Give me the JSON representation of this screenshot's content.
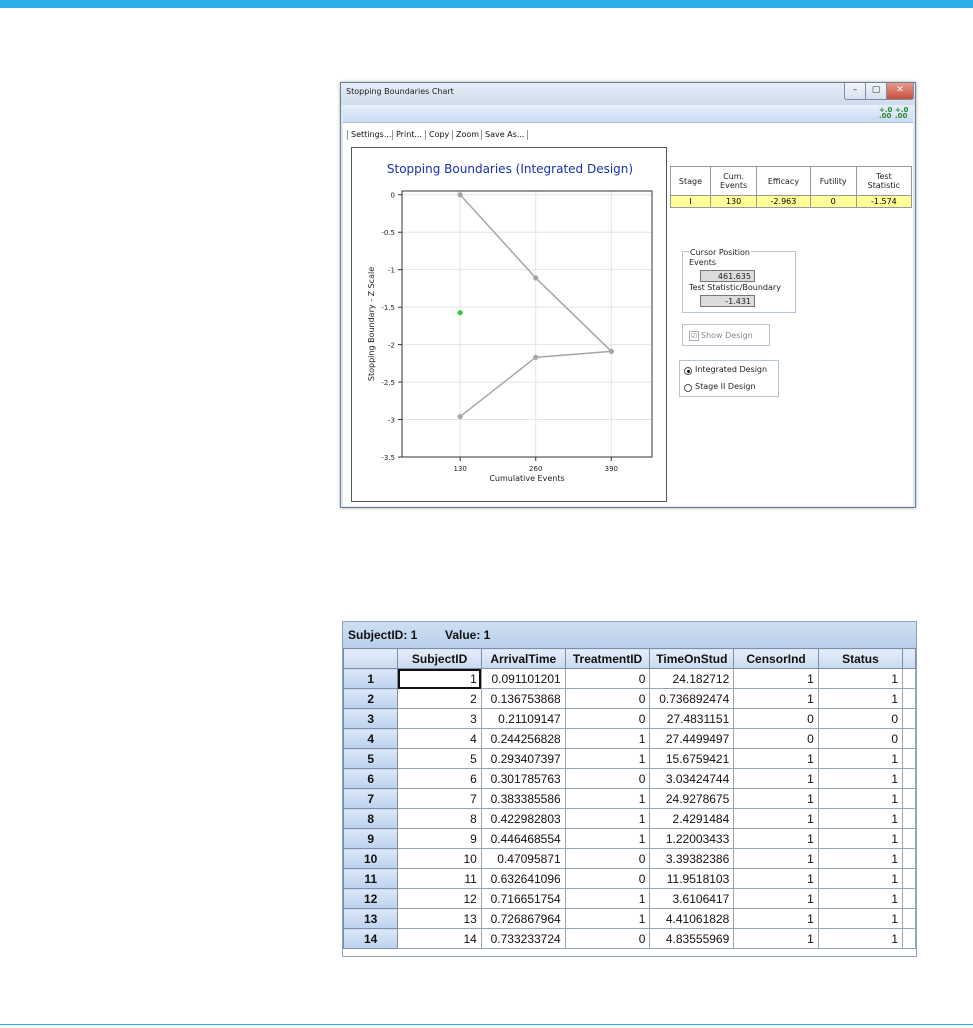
{
  "window": {
    "title": "Stopping Boundaries Chart",
    "min_glyph": "–",
    "max_glyph": "▢",
    "close_glyph": "✕",
    "tool_icon_1": "+.0 .00",
    "tool_icon_2": "+.0 .00"
  },
  "menu": {
    "settings": "Settings...",
    "print": "Print...",
    "copy": "Copy",
    "zoom": "Zoom",
    "save_as": "Save As..."
  },
  "chart_data": {
    "type": "line",
    "title": "Stopping Boundaries (Integrated Design)",
    "xlabel": "Cumulative Events",
    "ylabel": "Stopping Boundary - Z Scale",
    "x_ticks": [
      130,
      260,
      390
    ],
    "y_ticks": [
      0,
      -0.5,
      -1,
      -1.5,
      -2,
      -2.5,
      -3,
      -3.5
    ],
    "y_tick_labels": [
      "0",
      "-0.5",
      "-1",
      "-1.5",
      "-2",
      "-2.5",
      "-3",
      "-3.5"
    ],
    "xlim": [
      30,
      460
    ],
    "ylim": [
      -3.5,
      0.05
    ],
    "grid": true,
    "series": [
      {
        "color": "#a6a6a6",
        "points": [
          [
            130,
            0
          ],
          [
            260,
            -1.11
          ],
          [
            390,
            -2.09
          ]
        ]
      },
      {
        "color": "#a6a6a6",
        "points": [
          [
            130,
            -2.96
          ],
          [
            260,
            -2.17
          ],
          [
            390,
            -2.09
          ]
        ]
      }
    ],
    "markers": [
      {
        "color": "#33cc33",
        "points": [
          [
            130,
            -1.574
          ]
        ]
      }
    ]
  },
  "stage_table": {
    "headers": [
      "Stage",
      "Cum.\nEvents",
      "Efficacy",
      "Futility",
      "Test\nStatistic"
    ],
    "rows": [
      [
        "I",
        "130",
        "-2.963",
        "0",
        "-1.574"
      ]
    ]
  },
  "cursor": {
    "legend": "Cursor Position",
    "events_label": "Events",
    "events_value": "461.635",
    "ts_label": "Test Statistic/Boundary",
    "ts_value": "-1.431"
  },
  "show_design": {
    "label": "Show Design",
    "check": "☑"
  },
  "design_options": {
    "integrated": "Integrated Design",
    "stage2": "Stage II Design"
  },
  "datagrid": {
    "subject_label": "SubjectID: 1",
    "value_label": "Value: 1",
    "columns": [
      "SubjectID",
      "ArrivalTime",
      "TreatmentID",
      "TimeOnStud",
      "CensorInd",
      "Status"
    ],
    "rows": [
      [
        "1",
        "1",
        "0.091101201",
        "0",
        "24.182712",
        "1",
        "1"
      ],
      [
        "2",
        "2",
        "0.136753868",
        "0",
        "0.736892474",
        "1",
        "1"
      ],
      [
        "3",
        "3",
        "0.21109147",
        "0",
        "27.4831151",
        "0",
        "0"
      ],
      [
        "4",
        "4",
        "0.244256828",
        "1",
        "27.4499497",
        "0",
        "0"
      ],
      [
        "5",
        "5",
        "0.293407397",
        "1",
        "15.6759421",
        "1",
        "1"
      ],
      [
        "6",
        "6",
        "0.301785763",
        "0",
        "3.03424744",
        "1",
        "1"
      ],
      [
        "7",
        "7",
        "0.383385586",
        "1",
        "24.9278675",
        "1",
        "1"
      ],
      [
        "8",
        "8",
        "0.422982803",
        "1",
        "2.4291484",
        "1",
        "1"
      ],
      [
        "9",
        "9",
        "0.446468554",
        "1",
        "1.22003433",
        "1",
        "1"
      ],
      [
        "10",
        "10",
        "0.47095871",
        "0",
        "3.39382386",
        "1",
        "1"
      ],
      [
        "11",
        "11",
        "0.632641096",
        "0",
        "11.9518103",
        "1",
        "1"
      ],
      [
        "12",
        "12",
        "0.716651754",
        "1",
        "3.6106417",
        "1",
        "1"
      ],
      [
        "13",
        "13",
        "0.726867964",
        "1",
        "4.41061828",
        "1",
        "1"
      ],
      [
        "14",
        "14",
        "0.733233724",
        "0",
        "4.83555969",
        "1",
        "1"
      ]
    ]
  }
}
